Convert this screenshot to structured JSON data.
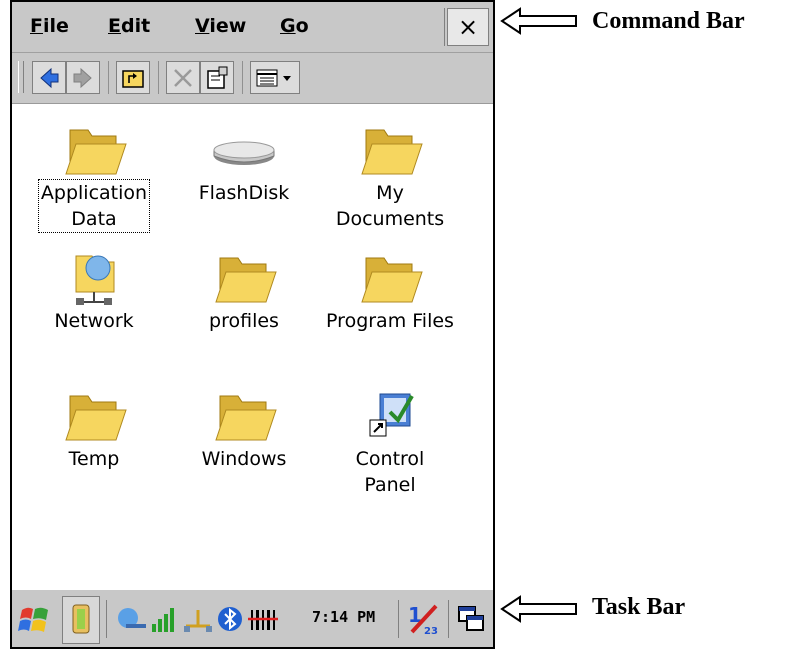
{
  "menu": {
    "file": "File",
    "edit": "Edit",
    "view": "View",
    "go": "Go",
    "close": "×"
  },
  "toolbar": {
    "buttons": [
      "back-icon",
      "forward-icon",
      "up-folder-icon",
      "delete-icon",
      "properties-icon",
      "view-options-icon"
    ]
  },
  "items": [
    {
      "label": "Application\nData",
      "icon": "folder-icon"
    },
    {
      "label": "FlashDisk",
      "icon": "flash-disk-icon"
    },
    {
      "label": "My\nDocuments",
      "icon": "folder-icon"
    },
    {
      "label": "Network",
      "icon": "network-icon"
    },
    {
      "label": "profiles",
      "icon": "folder-icon"
    },
    {
      "label": "Program Files",
      "icon": "folder-icon"
    },
    {
      "label": "Temp",
      "icon": "folder-icon"
    },
    {
      "label": "Windows",
      "icon": "folder-icon"
    },
    {
      "label": "Control\nPanel",
      "icon": "control-panel-icon"
    }
  ],
  "taskbar": {
    "clock": "7:14 PM",
    "icons": [
      "start-icon",
      "battery-icon",
      "connection-icon",
      "signal-icon",
      "network-status-icon",
      "bluetooth-icon",
      "scanner-icon",
      "input-panel-icon",
      "switch-window-icon"
    ]
  },
  "annotations": {
    "command_bar": "Command Bar",
    "task_bar": "Task Bar"
  },
  "colors": {
    "bar": "#c8c8c8",
    "folder": "#f6d65f",
    "folder_shade": "#d8b038"
  }
}
